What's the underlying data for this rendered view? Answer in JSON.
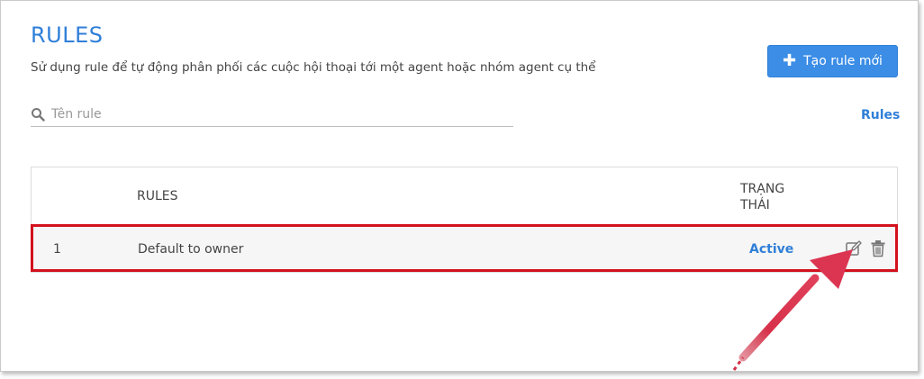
{
  "header": {
    "title": "RULES",
    "description": "Sử dụng rule để tự động phân phối các cuộc hội thoại tới một agent hoặc nhóm agent cụ thể",
    "create_button_label": "Tạo rule mới"
  },
  "search": {
    "placeholder": "Tên rule",
    "value": ""
  },
  "rules_link": "Rules",
  "table": {
    "columns": {
      "rules": "RULES",
      "status_line1": "TRẠNG",
      "status_line2": "THÁI"
    },
    "rows": [
      {
        "index": "1",
        "name": "Default to owner",
        "status": "Active"
      }
    ]
  },
  "icons": [
    "plus-icon",
    "search-icon",
    "edit-icon",
    "trash-icon"
  ],
  "colors": {
    "accent": "#2f7fd8",
    "button": "#3b8de6",
    "highlight": "#d3111e",
    "arrow": "#d9304a"
  }
}
